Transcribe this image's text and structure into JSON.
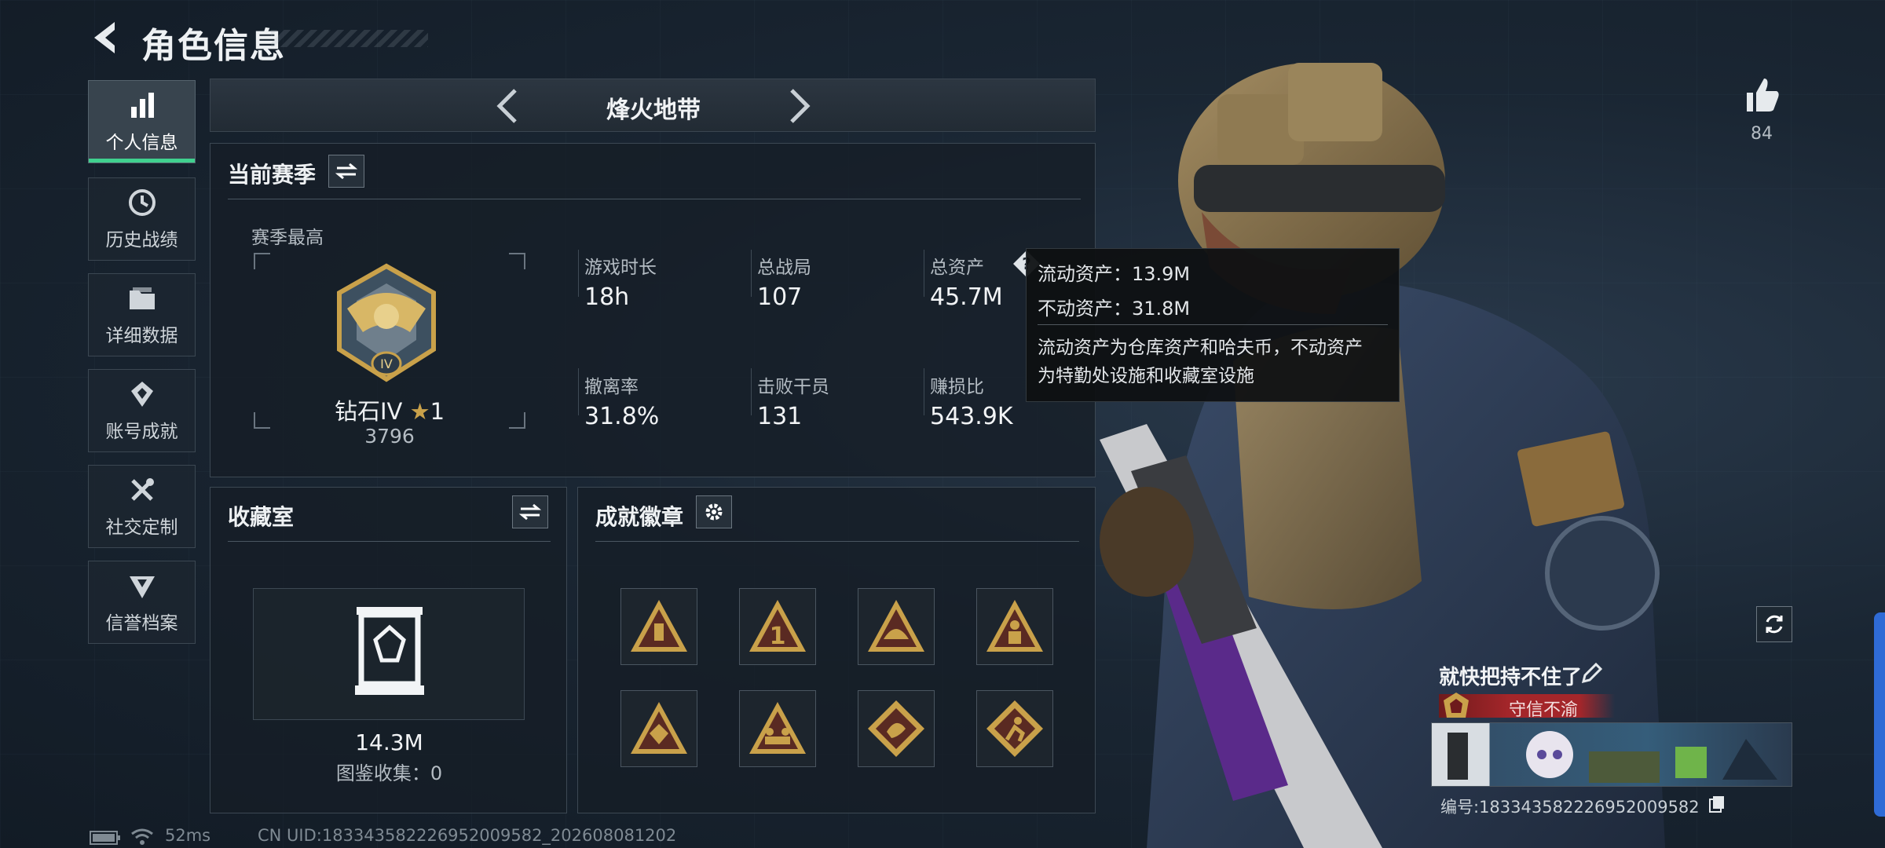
{
  "header": {
    "title": "角色信息"
  },
  "nav": [
    {
      "label": "个人信息",
      "icon": "bar-chart-icon",
      "active": true
    },
    {
      "label": "历史战绩",
      "icon": "history-icon",
      "active": false
    },
    {
      "label": "详细数据",
      "icon": "folder-icon",
      "active": false
    },
    {
      "label": "账号成就",
      "icon": "achievement-icon",
      "active": false
    },
    {
      "label": "社交定制",
      "icon": "tools-icon",
      "active": false
    },
    {
      "label": "信誉档案",
      "icon": "shield-badge-icon",
      "active": false
    }
  ],
  "mode": {
    "title": "烽火地带"
  },
  "season": {
    "title": "当前赛季",
    "best_label": "赛季最高",
    "rank_name": "钻石IV",
    "rank_stars": "1",
    "rank_score": "3796",
    "stats": [
      {
        "label": "游戏时长",
        "value": "18h"
      },
      {
        "label": "总战局",
        "value": "107"
      },
      {
        "label": "总资产",
        "value": "45.7M"
      },
      {
        "label": "撤离率",
        "value": "31.8%"
      },
      {
        "label": "击败干员",
        "value": "131"
      },
      {
        "label": "赚损比",
        "value": "543.9K"
      }
    ]
  },
  "tooltip": {
    "liquid": "流动资产：13.9M",
    "fixed": "不动资产：31.8M",
    "desc_line1": "流动资产为仓库资产和哈夫币，不动资产",
    "desc_line2": "为特勤处设施和收藏室设施"
  },
  "collection": {
    "title": "收藏室",
    "value": "14.3M",
    "catalog": "图鉴收集：0"
  },
  "badges": {
    "title": "成就徽章",
    "items": [
      "badge-bottle-icon",
      "badge-number-one-icon",
      "badge-helmet-icon",
      "badge-soldier-icon",
      "badge-emblem-icon",
      "badge-squad-icon",
      "badge-dragon-icon",
      "badge-runner-icon"
    ]
  },
  "player": {
    "likes": "84",
    "name": "就快把持不住了",
    "title_badge": "守信不渝",
    "id_text": "编号:1833435822269520095​82"
  },
  "status": {
    "ping": "52ms",
    "uid": "CN UID:18334358222695200958​2_202608081202"
  },
  "colors": {
    "accent": "#40d18f",
    "badge_gold": "#c9a14a",
    "title_red": "#a4262a"
  }
}
